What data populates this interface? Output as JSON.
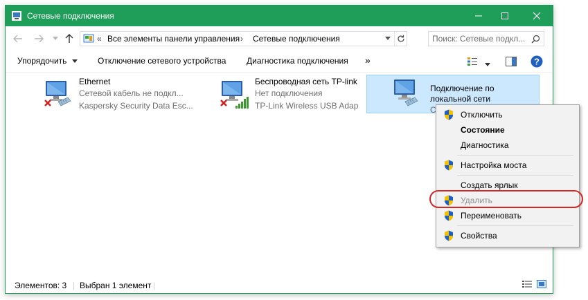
{
  "window": {
    "title": "Сетевые подключения"
  },
  "address": {
    "breadcrumbs": [
      "Все элементы панели управления",
      "Сетевые подключения"
    ],
    "prefix": "«"
  },
  "search": {
    "placeholder": "Поиск: Сетевые подкл..."
  },
  "toolbar": {
    "organize": "Упорядочить",
    "disable_device": "Отключение сетевого устройства",
    "diagnose": "Диагностика подключения",
    "more": "»"
  },
  "items": [
    {
      "name": "Ethernet",
      "status": "Сетевой кабель не подкл...",
      "device": "Kaspersky Security Data Esc..."
    },
    {
      "name": "Беспроводная сеть TP-link",
      "status": "Нет подключения",
      "device": "TP-Link Wireless USB Adap"
    },
    {
      "name_line1": "Подключение по",
      "name_line2": "локальной сети",
      "partial": "С"
    }
  ],
  "context_menu": {
    "items": [
      {
        "label": "Отключить",
        "shield": true
      },
      {
        "label": "Состояние",
        "bold": true
      },
      {
        "label": "Диагностика"
      },
      {
        "label": "Настройка моста",
        "shield": true
      },
      {
        "label": "Создать ярлык"
      },
      {
        "label": "Удалить",
        "shield": true,
        "disabled": true
      },
      {
        "label": "Переименовать",
        "shield": true
      },
      {
        "label": "Свойства",
        "shield": true
      }
    ]
  },
  "status_bar": {
    "count": "Элементов: 3",
    "selected": "Выбран 1 элемент"
  },
  "colors": {
    "titlebar": "#1e9e59",
    "selection": "#cce8ff",
    "highlight_ring": "#d32626"
  }
}
